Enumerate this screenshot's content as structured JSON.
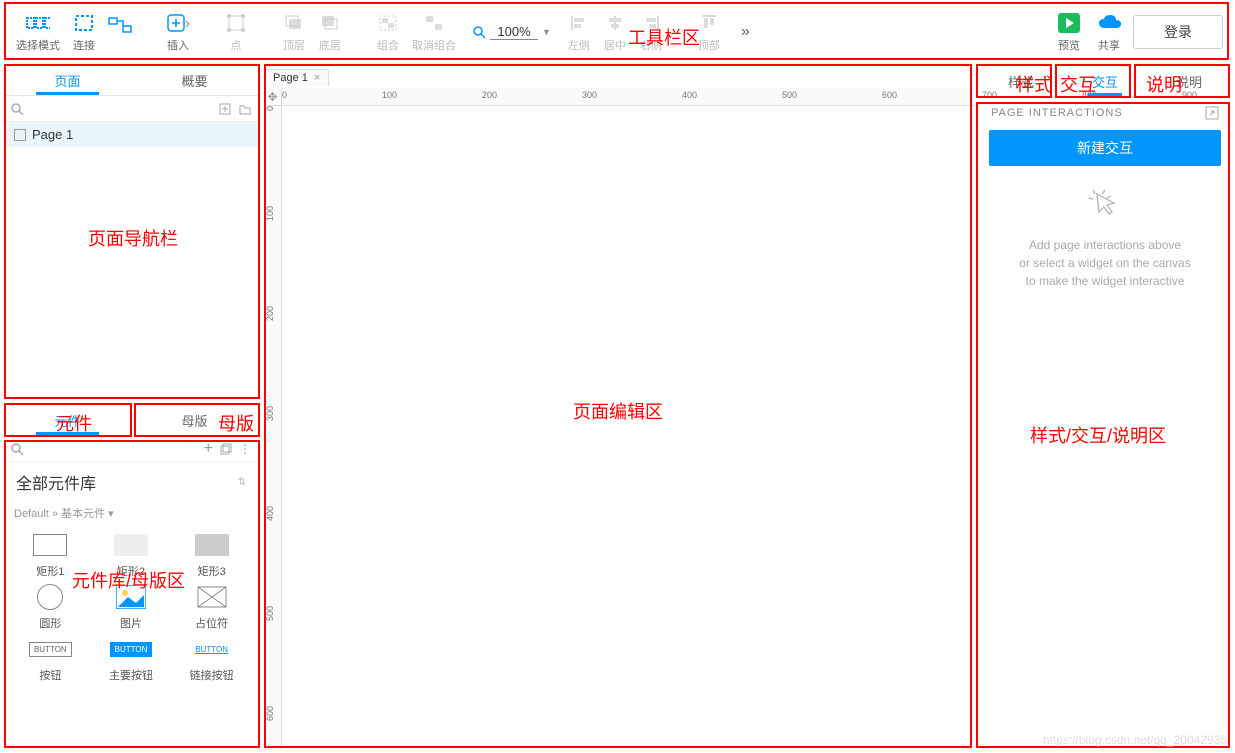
{
  "toolbar": {
    "select_mode": "选择模式",
    "connect": "连接",
    "insert": "插入",
    "point": "点",
    "front": "顶层",
    "back": "底层",
    "group": "组合",
    "ungroup": "取消组合",
    "zoom_value": "100%",
    "align_left": "左侧",
    "align_center": "居中",
    "align_right": "右侧",
    "align_top": "顶部",
    "preview": "预览",
    "share": "共享",
    "login": "登录"
  },
  "left": {
    "tab_pages": "页面",
    "tab_outline": "概要",
    "page1": "Page 1",
    "tab_widgets": "元件",
    "tab_masters": "母版",
    "lib_all": "全部元件库",
    "lib_sub": "Default » 基本元件 ▾",
    "widgets": {
      "rect1": "矩形1",
      "rect2": "矩形2",
      "rect3": "矩形3",
      "circle": "圆形",
      "image": "图片",
      "placeholder": "占位符",
      "button": "按钮",
      "primary_button": "主要按钮",
      "link_button": "链接按钮",
      "btn_tag": "BUTTON"
    }
  },
  "center": {
    "tab_name": "Page 1",
    "ruler_ticks_h": [
      "0",
      "100",
      "200",
      "300",
      "400",
      "500",
      "600",
      "700",
      "800",
      "900"
    ],
    "ruler_ticks_v": [
      "0",
      "100",
      "200",
      "300",
      "400",
      "500",
      "600"
    ]
  },
  "right": {
    "tab_style": "样式",
    "tab_interact": "交互",
    "tab_notes": "说明",
    "section_title": "PAGE INTERACTIONS",
    "new_btn": "新建交互",
    "empty1": "Add page interactions above",
    "empty2": "or select a widget on the canvas",
    "empty3": "to make the widget interactive"
  },
  "annotations": {
    "toolbar": "工具栏区",
    "page_nav": "页面导航栏",
    "widgets_big": "元件",
    "masters_big": "母版",
    "widget_lib": "元件库/母版区",
    "canvas": "页面编辑区",
    "style_big": "样式",
    "interact_big": "交互",
    "notes_big": "说明",
    "right_area": "样式/交互/说明区"
  },
  "watermark": "https://blog.csdn.net/qq_20042935"
}
